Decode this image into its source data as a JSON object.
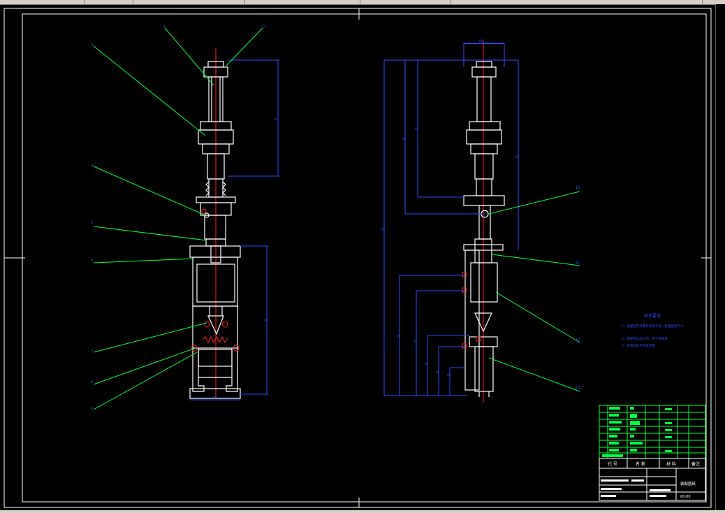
{
  "tech_requirements": {
    "title": "技术要求",
    "items": [
      "1、装配前所有零件清洗干净，检查配合尺寸",
      "2、装配后运动灵活，无卡滞现象",
      "3、各密封处不得有泄漏"
    ]
  },
  "title_block": {
    "header_code": "代 号",
    "header_name": "名 称",
    "header_material": "材 料",
    "header_remark": "备注",
    "drawing_name": "装配图纸",
    "drawing_no": "00-00"
  },
  "colors": {
    "frame": "#ffffff",
    "outline": "#ffffff",
    "dimension": "#2a4dff",
    "leader": "#00ff40",
    "centerline": "#ff2020",
    "background": "#000000"
  }
}
